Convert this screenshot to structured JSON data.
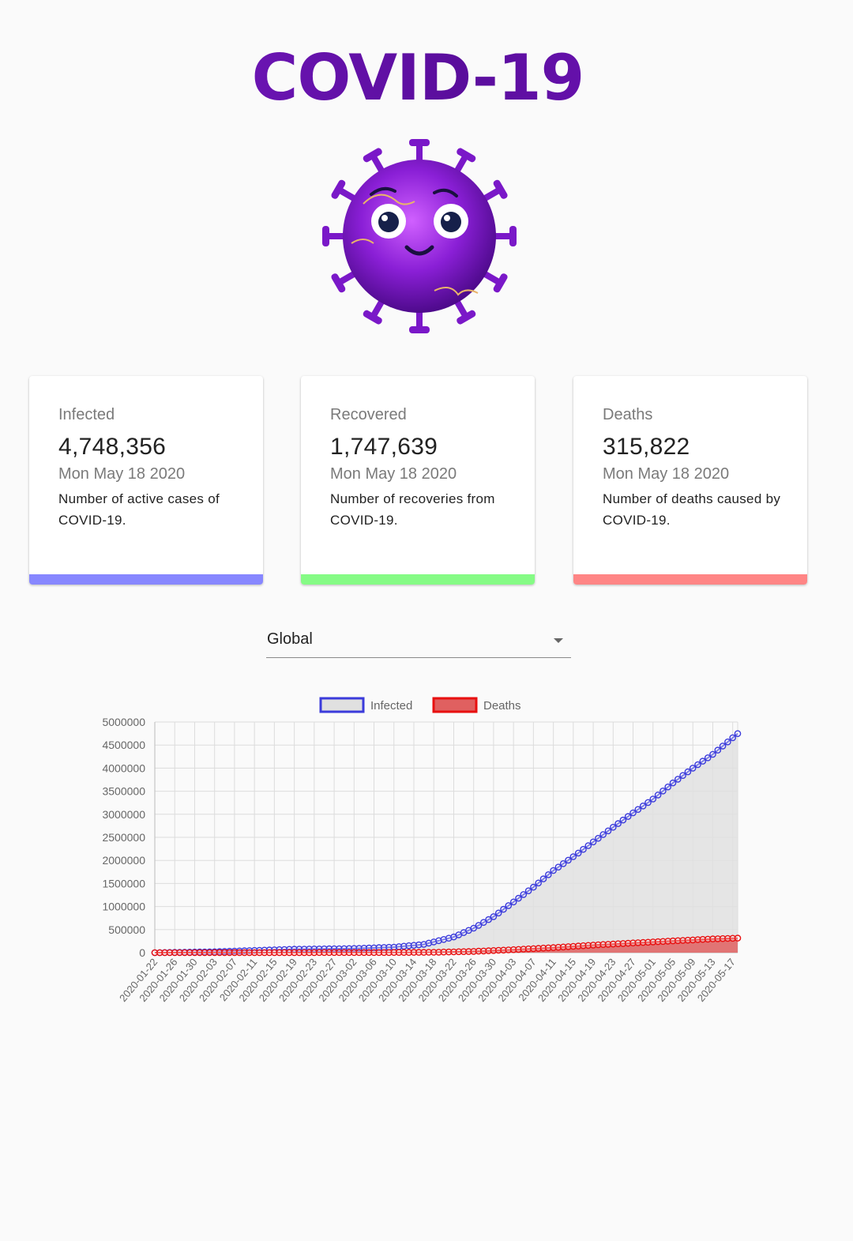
{
  "header": {
    "title": "COVID-19"
  },
  "mascot": {
    "icon": "virus-mascot-icon",
    "colors": {
      "body": "#8a1fd6",
      "spikes": "#7a18c8"
    }
  },
  "cards": [
    {
      "label": "Infected",
      "value": "4,748,356",
      "date": "Mon May 18 2020",
      "description": "Number of active cases of COVID-19.",
      "color": "#8787ff"
    },
    {
      "label": "Recovered",
      "value": "1,747,639",
      "date": "Mon May 18 2020",
      "description": "Number of recoveries from COVID-19.",
      "color": "#85fb85"
    },
    {
      "label": "Deaths",
      "value": "315,822",
      "date": "Mon May 18 2020",
      "description": "Number of deaths caused by COVID-19.",
      "color": "#ff8585"
    }
  ],
  "country_select": {
    "value": "Global"
  },
  "chart_data": {
    "type": "line",
    "legend_position": "top",
    "grid": true,
    "ylim": [
      0,
      5000000
    ],
    "y_ticks": [
      0,
      500000,
      1000000,
      1500000,
      2000000,
      2500000,
      3000000,
      3500000,
      4000000,
      4500000,
      5000000
    ],
    "x_tick_labels": [
      "2020-01-22",
      "2020-01-26",
      "2020-01-30",
      "2020-02-03",
      "2020-02-07",
      "2020-02-11",
      "2020-02-15",
      "2020-02-19",
      "2020-02-23",
      "2020-02-27",
      "2020-03-02",
      "2020-03-06",
      "2020-03-10",
      "2020-03-14",
      "2020-03-18",
      "2020-03-22",
      "2020-03-26",
      "2020-03-30",
      "2020-04-03",
      "2020-04-07",
      "2020-04-11",
      "2020-04-15",
      "2020-04-19",
      "2020-04-23",
      "2020-04-27",
      "2020-05-01",
      "2020-05-05",
      "2020-05-09",
      "2020-05-13",
      "2020-05-17"
    ],
    "x_start": "2020-01-22",
    "x_end": "2020-05-18",
    "series": [
      {
        "name": "Infected",
        "color": "#3b3bdb",
        "fill": "#e0e0e0",
        "anchors": [
          [
            "2020-01-22",
            600
          ],
          [
            "2020-02-03",
            20000
          ],
          [
            "2020-02-19",
            75000
          ],
          [
            "2020-03-02",
            90000
          ],
          [
            "2020-03-10",
            120000
          ],
          [
            "2020-03-16",
            180000
          ],
          [
            "2020-03-22",
            340000
          ],
          [
            "2020-03-26",
            530000
          ],
          [
            "2020-03-30",
            780000
          ],
          [
            "2020-04-03",
            1100000
          ],
          [
            "2020-04-07",
            1420000
          ],
          [
            "2020-04-11",
            1780000
          ],
          [
            "2020-04-15",
            2080000
          ],
          [
            "2020-04-19",
            2400000
          ],
          [
            "2020-04-23",
            2720000
          ],
          [
            "2020-04-27",
            3030000
          ],
          [
            "2020-05-01",
            3330000
          ],
          [
            "2020-05-05",
            3680000
          ],
          [
            "2020-05-09",
            4000000
          ],
          [
            "2020-05-13",
            4300000
          ],
          [
            "2020-05-18",
            4748356
          ]
        ]
      },
      {
        "name": "Deaths",
        "color": "#e81010",
        "fill": "#e06060",
        "anchors": [
          [
            "2020-01-22",
            17
          ],
          [
            "2020-02-19",
            2100
          ],
          [
            "2020-03-10",
            4300
          ],
          [
            "2020-03-18",
            8700
          ],
          [
            "2020-03-26",
            27000
          ],
          [
            "2020-04-03",
            65000
          ],
          [
            "2020-04-11",
            110000
          ],
          [
            "2020-04-19",
            165000
          ],
          [
            "2020-04-27",
            210000
          ],
          [
            "2020-05-05",
            255000
          ],
          [
            "2020-05-13",
            298000
          ],
          [
            "2020-05-18",
            315822
          ]
        ]
      }
    ]
  }
}
